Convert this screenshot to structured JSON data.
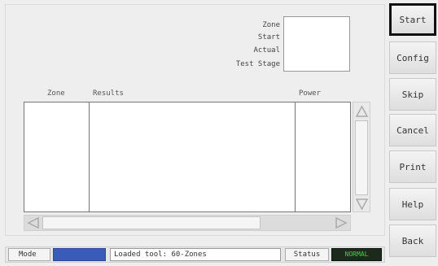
{
  "info": {
    "zone_label": "Zone",
    "start_label": "Start",
    "actual_label": "Actual",
    "test_stage_label": "Test Stage"
  },
  "table": {
    "headers": {
      "zone": "Zone",
      "results": "Results",
      "power": "Power"
    }
  },
  "sidebar": {
    "buttons": [
      "Start",
      "Config",
      "Skip",
      "Cancel",
      "Print",
      "Help",
      "Back"
    ]
  },
  "status_bar": {
    "mode_label": "Mode",
    "message": "Loaded tool: 60-Zones",
    "status_label": "Status",
    "status_value": "NORMAL"
  },
  "colors": {
    "mode_indicator": "#3a5bb8",
    "status_indicator_bg": "#1b2a1b",
    "status_indicator_text": "#3fd24a"
  },
  "icons": {
    "scroll_up": "triangle-up-icon",
    "scroll_down": "triangle-down-icon",
    "scroll_left": "triangle-left-icon",
    "scroll_right": "triangle-right-icon"
  }
}
